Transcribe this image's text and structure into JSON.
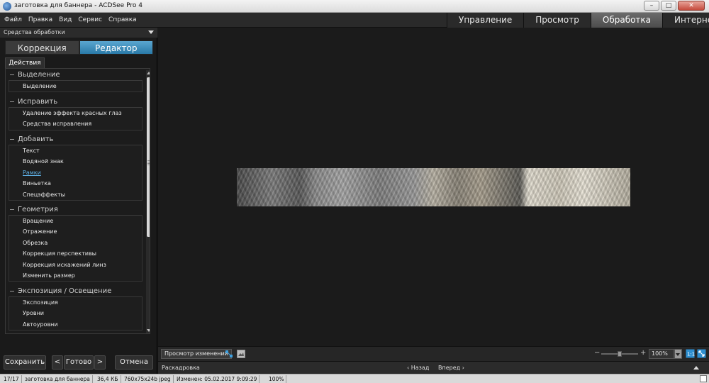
{
  "window": {
    "title": "заготовка для баннера - ACDSee Pro 4",
    "buttons": {
      "minimize": "–",
      "maximize": "□",
      "close": "✕"
    }
  },
  "menu": [
    "Файл",
    "Правка",
    "Вид",
    "Сервис",
    "Справка"
  ],
  "mode_tabs": {
    "items": [
      "Управление",
      "Просмотр",
      "Обработка",
      "Интернет"
    ],
    "active": "Обработка"
  },
  "left_panel": {
    "header": "Средства обработки",
    "mode_switch": {
      "left": "Коррекция",
      "right": "Редактор",
      "active": "Редактор"
    },
    "actions_tab": "Действия",
    "groups": [
      {
        "title": "Выделение",
        "items": [
          "Выделение"
        ]
      },
      {
        "title": "Исправить",
        "items": [
          "Удаление эффекта красных глаз",
          "Средства исправления"
        ]
      },
      {
        "title": "Добавить",
        "items": [
          "Текст",
          "Водяной знак",
          "Рамки",
          "Виньетка",
          "Спецэффекты"
        ],
        "highlighted": "Рамки"
      },
      {
        "title": "Геометрия",
        "items": [
          "Вращение",
          "Отражение",
          "Обрезка",
          "Коррекция перспективы",
          "Коррекция искажений линз",
          "Изменить размер"
        ]
      },
      {
        "title": "Экспозиция / Освещение",
        "items": [
          "Экспозиция",
          "Уровни",
          "Автоуровни"
        ]
      }
    ],
    "buttons": {
      "save": "Сохранить",
      "prev": "<",
      "done": "Готово",
      "next": ">",
      "cancel": "Отмена"
    }
  },
  "preview_toolbar": {
    "view_changes": "Просмотр изменений",
    "zoom_minus": "−",
    "zoom_plus": "+",
    "zoom_value": "100%",
    "zoom_level": 0.5
  },
  "filmstrip": {
    "label": "Раскадровка",
    "back": "‹ Назад",
    "forward": "Вперед ›"
  },
  "status_bar": {
    "position": "17/17",
    "filename": "заготовка для баннера",
    "size": "36,4 КБ",
    "dimensions": "760x75x24b jpeg",
    "modified": "Изменен: 05.02.2017 9:09:29",
    "zoom": "100%"
  },
  "colors": {
    "accent": "#2f86c0",
    "link": "#5fb2e8",
    "background": "#1b1b1b"
  }
}
